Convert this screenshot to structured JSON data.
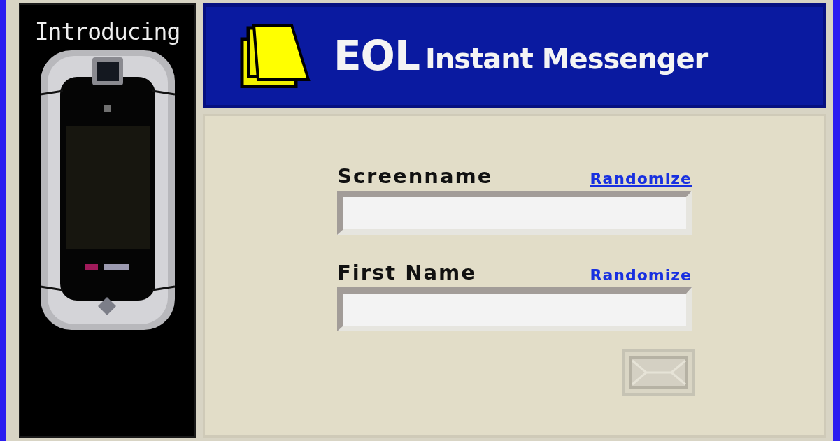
{
  "promo": {
    "title": "Introducing"
  },
  "header": {
    "brand": "EOL",
    "subtitle": "Instant Messenger"
  },
  "fields": [
    {
      "label": "Screenname",
      "link": "Randomize",
      "hovered": true
    },
    {
      "label": "First Name",
      "link": "Randomize",
      "hovered": false
    }
  ],
  "submit": {
    "disabled": true
  }
}
